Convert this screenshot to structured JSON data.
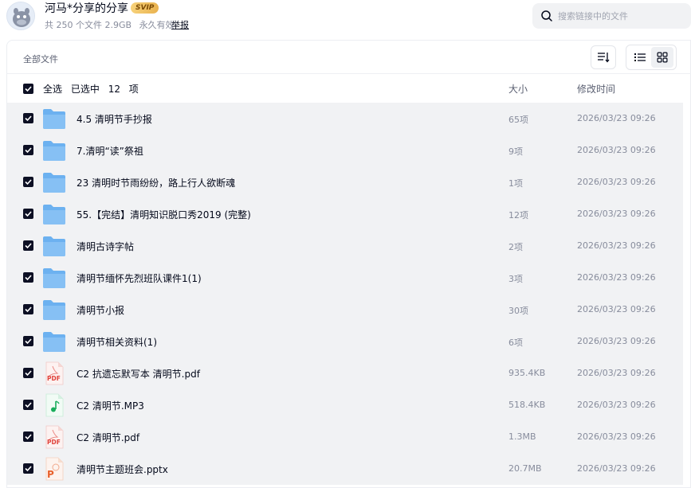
{
  "header": {
    "share_title": "河马*分享的分享",
    "badge": "SVIP",
    "file_count": "共 250 个文件 2.9GB",
    "validity": "永久有效",
    "report": "举报"
  },
  "search": {
    "placeholder": "搜索链接中的文件"
  },
  "toolbar": {
    "breadcrumb": "全部文件",
    "sort_icon": "sort-icon",
    "list_view_icon": "list-view-icon",
    "grid_view_icon": "grid-view-icon"
  },
  "table": {
    "select_all": "全选",
    "selected_label": "已选中",
    "selected_count": "12",
    "selected_unit": "项",
    "col_size": "大小",
    "col_time": "修改时间"
  },
  "files": [
    {
      "name": "4.5 清明节手抄报",
      "size": "65项",
      "time": "2026/03/23 09:26",
      "type": "folder"
    },
    {
      "name": "7.清明“读”祭祖",
      "size": "9项",
      "time": "2026/03/23 09:26",
      "type": "folder"
    },
    {
      "name": "23 清明时节雨纷纷，路上行人欲断魂",
      "size": "1项",
      "time": "2026/03/23 09:26",
      "type": "folder"
    },
    {
      "name": "55.【完结】清明知识脱口秀2019 (完整)",
      "size": "12项",
      "time": "2026/03/23 09:26",
      "type": "folder"
    },
    {
      "name": "清明古诗字帖",
      "size": "2项",
      "time": "2026/03/23 09:26",
      "type": "folder"
    },
    {
      "name": "清明节缅怀先烈班队课件1(1)",
      "size": "3项",
      "time": "2026/03/23 09:26",
      "type": "folder"
    },
    {
      "name": "清明节小报",
      "size": "30项",
      "time": "2026/03/23 09:26",
      "type": "folder"
    },
    {
      "name": "清明节相关资料(1)",
      "size": "6项",
      "time": "2026/03/23 09:26",
      "type": "folder"
    },
    {
      "name": "C2 抗遗忘默写本 清明节.pdf",
      "size": "935.4KB",
      "time": "2026/03/23 09:26",
      "type": "pdf"
    },
    {
      "name": "C2 清明节.MP3",
      "size": "518.4KB",
      "time": "2026/03/23 09:26",
      "type": "audio"
    },
    {
      "name": "C2 清明节.pdf",
      "size": "1.3MB",
      "time": "2026/03/23 09:26",
      "type": "pdf"
    },
    {
      "name": "清明节主题班会.pptx",
      "size": "20.7MB",
      "time": "2026/03/23 09:26",
      "type": "ppt"
    }
  ],
  "colors": {
    "checkbox": "#0d1024",
    "folder": "#6cb1f0",
    "pdf": "#e0413a",
    "audio": "#1aad5c",
    "ppt": "#e8612c",
    "row_bg": "#f1f2f4"
  }
}
